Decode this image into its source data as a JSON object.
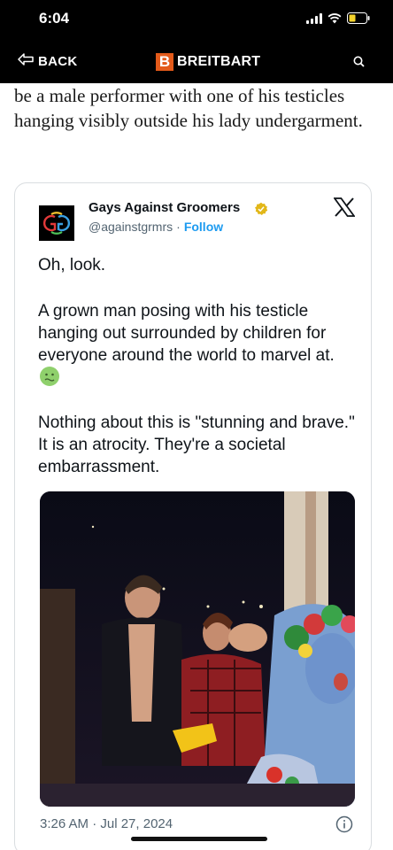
{
  "status_bar": {
    "time": "6:04"
  },
  "nav": {
    "back_label": "BACK",
    "brand_letter": "B",
    "brand_name": "BREITBART"
  },
  "article": {
    "text": "be a male performer with one of his testicles hanging visibly outside his lady undergarment."
  },
  "tweet": {
    "author_name": "Gays Against Groomers",
    "handle": "@againstgrmrs",
    "separator": "·",
    "follow_label": "Follow",
    "paragraphs": [
      "Oh, look.",
      "A grown man posing with his testicle hanging out surrounded by children for everyone around the world to marvel at.",
      "Nothing about this is \"stunning and brave.\" It is an atrocity. They're a societal embarrassment."
    ],
    "timestamp": "3:26 AM · Jul 27, 2024"
  },
  "icons": {
    "back": "back-arrow-icon",
    "search": "search-icon",
    "x_logo": "x-logo-icon",
    "verified": "verified-badge-icon",
    "emoji": "nauseated-face-icon",
    "info": "info-icon"
  },
  "colors": {
    "brand_orange": "#e35a1a",
    "link_blue": "#1d9bf0",
    "verified_gold": "#e2b719"
  }
}
